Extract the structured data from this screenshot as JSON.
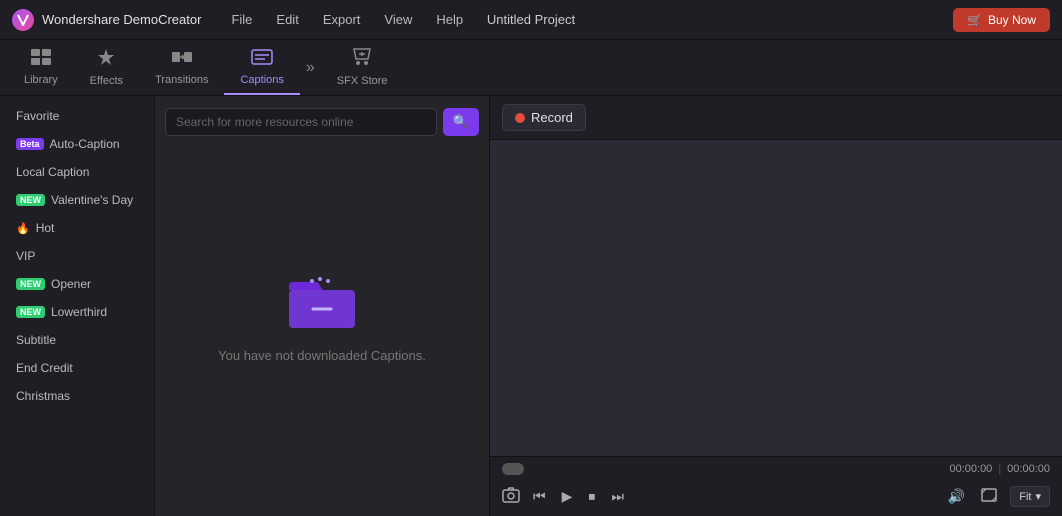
{
  "titlebar": {
    "logo_text": "W",
    "app_name": "Wondershare DemoCreator",
    "menu": [
      "File",
      "Edit",
      "Export",
      "View",
      "Help"
    ],
    "project_title": "Untitled Project",
    "buy_now_label": "Buy Now"
  },
  "toolbar": {
    "tabs": [
      {
        "id": "library",
        "label": "Library",
        "icon": "⊞",
        "active": false
      },
      {
        "id": "effects",
        "label": "Effects",
        "icon": "✦",
        "active": false
      },
      {
        "id": "transitions",
        "label": "Transitions",
        "icon": "⇄",
        "active": false
      },
      {
        "id": "captions",
        "label": "Captions",
        "icon": "⊡",
        "active": true
      },
      {
        "id": "sfx-store",
        "label": "SFX Store",
        "icon": "♪",
        "active": false
      }
    ],
    "more_icon": "»"
  },
  "sidebar": {
    "items": [
      {
        "label": "Favorite",
        "badge": null
      },
      {
        "label": "Auto-Caption",
        "badge": "Beta",
        "badge_type": "beta"
      },
      {
        "label": "Local Caption",
        "badge": null
      },
      {
        "label": "Valentine's Day",
        "badge": "NEW",
        "badge_type": "new"
      },
      {
        "label": "Hot",
        "badge": "🔥",
        "badge_type": "hot"
      },
      {
        "label": "VIP",
        "badge": null
      },
      {
        "label": "Opener",
        "badge": "NEW",
        "badge_type": "new"
      },
      {
        "label": "Lowerthird",
        "badge": "NEW",
        "badge_type": "new"
      },
      {
        "label": "Subtitle",
        "badge": null
      },
      {
        "label": "End Credit",
        "badge": null
      },
      {
        "label": "Christmas",
        "badge": null
      }
    ]
  },
  "content": {
    "search_placeholder": "Search for more resources online",
    "empty_message": "You have not downloaded Captions."
  },
  "preview": {
    "record_label": "Record",
    "time_current": "00:00:00",
    "time_separator": "|",
    "time_total": "00:00:00",
    "fit_label": "Fit"
  }
}
